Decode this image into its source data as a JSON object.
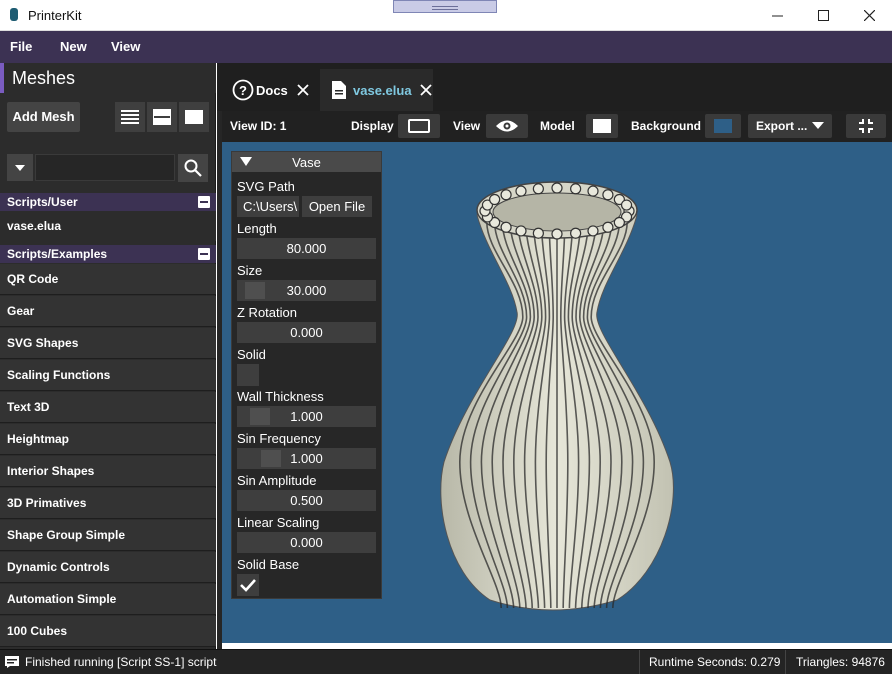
{
  "window": {
    "title": "PrinterKit"
  },
  "menu": {
    "items": [
      "File",
      "New",
      "View"
    ]
  },
  "sidebar": {
    "title": "Meshes",
    "add_mesh_label": "Add Mesh",
    "search_value": "",
    "groups": [
      {
        "name": "Scripts/User",
        "items": [
          "vase.elua"
        ]
      },
      {
        "name": "Scripts/Examples",
        "items": [
          "QR Code",
          "Gear",
          "SVG Shapes",
          "Scaling Functions",
          "Text 3D",
          "Heightmap",
          "Interior Shapes",
          "3D Primatives",
          "Shape Group Simple",
          "Dynamic Controls",
          "Automation Simple",
          "100 Cubes"
        ]
      }
    ]
  },
  "tabs": [
    {
      "label": "Docs",
      "icon": "help-circle-icon",
      "active": false
    },
    {
      "label": "vase.elua",
      "icon": "document-icon",
      "active": true
    }
  ],
  "toolbar": {
    "view_id": "View ID: 1",
    "display_label": "Display",
    "view_label": "View",
    "model_label": "Model",
    "background_label": "Background",
    "export_label": "Export ...",
    "model_color": "#ffffff",
    "background_color": "#2e5f87"
  },
  "panel": {
    "title": "Vase",
    "svg_path_label": "SVG Path",
    "svg_path_value": "C:\\Users\\",
    "open_file_label": "Open File",
    "length_label": "Length",
    "length_value": "80.000",
    "size_label": "Size",
    "size_value": "30.000",
    "zrot_label": "Z Rotation",
    "zrot_value": "0.000",
    "solid_label": "Solid",
    "solid_checked": false,
    "wall_label": "Wall Thickness",
    "wall_value": "1.000",
    "sinf_label": "Sin Frequency",
    "sinf_value": "1.000",
    "sina_label": "Sin Amplitude",
    "sina_value": "0.500",
    "lin_label": "Linear Scaling",
    "lin_value": "0.000",
    "base_label": "Solid Base",
    "base_checked": true
  },
  "status": {
    "message": "Finished running [Script SS-1] script",
    "runtime": "Runtime Seconds: 0.279",
    "triangles": "Triangles: 94876"
  },
  "colors": {
    "accent": "#3c3253",
    "viewport": "#2e5f87",
    "tab_active_text": "#7fc8e0"
  }
}
